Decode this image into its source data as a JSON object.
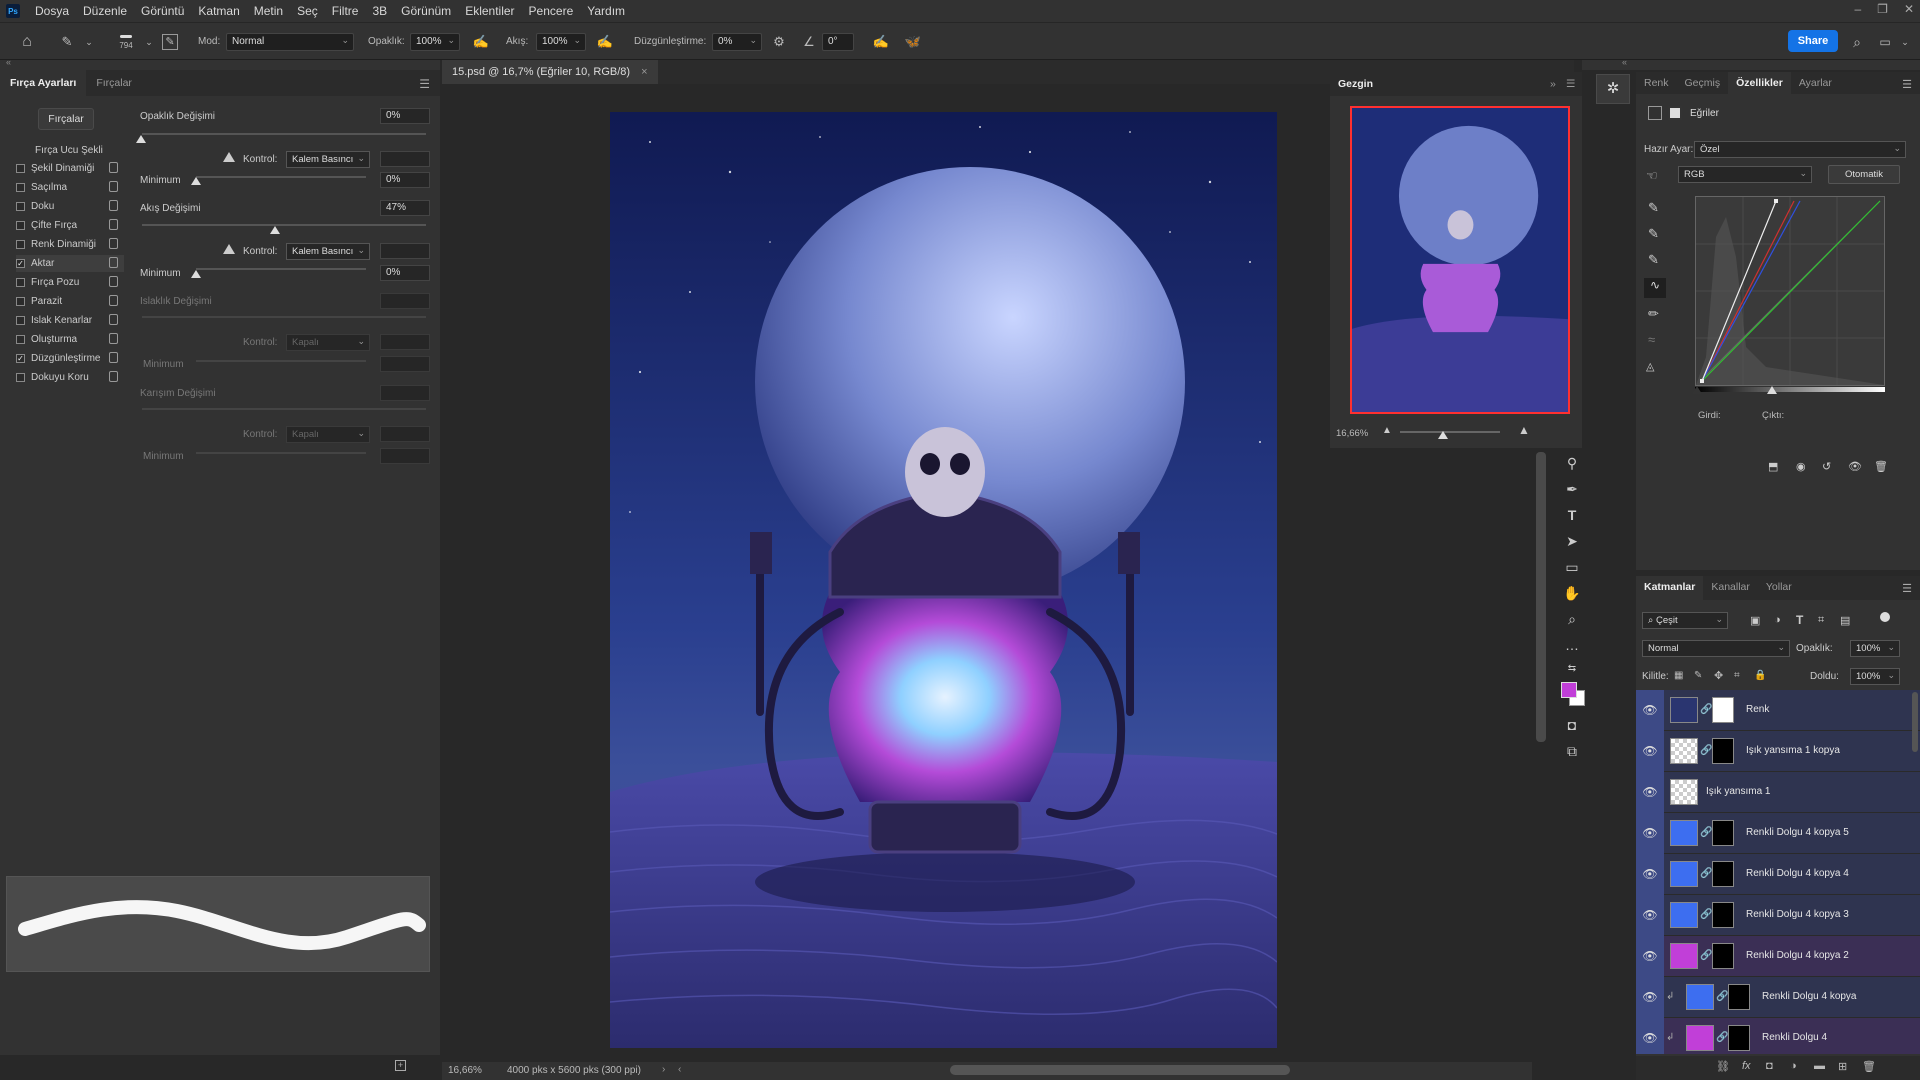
{
  "app": {
    "logo": "Ps"
  },
  "menu": [
    "Dosya",
    "Düzenle",
    "Görüntü",
    "Katman",
    "Metin",
    "Seç",
    "Filtre",
    "3B",
    "Görünüm",
    "Eklentiler",
    "Pencere",
    "Yardım"
  ],
  "options": {
    "brush_size": "794",
    "mode_label": "Mod:",
    "mode_value": "Normal",
    "opacity_label": "Opaklık:",
    "opacity_value": "100%",
    "flow_label": "Akış:",
    "flow_value": "100%",
    "smoothing_label": "Düzgünleştirme:",
    "smoothing_value": "0%",
    "angle_value": "0°",
    "share_label": "Share"
  },
  "brush_panel": {
    "tabs": [
      "Fırça Ayarları",
      "Fırçalar"
    ],
    "brushes_button": "Fırçalar",
    "tip_shape": "Fırça Ucu Şekli",
    "items": [
      {
        "label": "Şekil Dinamiği",
        "checked": false
      },
      {
        "label": "Saçılma",
        "checked": false
      },
      {
        "label": "Doku",
        "checked": false
      },
      {
        "label": "Çifte Fırça",
        "checked": false
      },
      {
        "label": "Renk Dinamiği",
        "checked": false
      },
      {
        "label": "Aktar",
        "checked": true
      },
      {
        "label": "Fırça Pozu",
        "checked": false
      },
      {
        "label": "Parazit",
        "checked": false
      },
      {
        "label": "Islak Kenarlar",
        "checked": false
      },
      {
        "label": "Oluşturma",
        "checked": false
      },
      {
        "label": "Düzgünleştirme",
        "checked": true
      },
      {
        "label": "Dokuyu Koru",
        "checked": false
      }
    ],
    "opacity_jitter": "Opaklık Değişimi",
    "opacity_jitter_value": "0%",
    "control": "Kontrol:",
    "pen_pressure": "Kalem Basıncı",
    "minimum": "Minimum",
    "min1_value": "0%",
    "flow_jitter": "Akış Değişimi",
    "flow_jitter_value": "47%",
    "min2_value": "0%",
    "wetness_jitter": "Islaklık Değişimi",
    "off": "Kapalı",
    "mix_jitter": "Karışım Değişimi"
  },
  "document": {
    "tab_title": "15.psd @ 16,7% (Eğriler 10, RGB/8)",
    "zoom": "16,66%",
    "info": "4000 pks x 5600 pks (300 ppi)"
  },
  "navigator": {
    "tab": "Gezgin",
    "zoom": "16,66%"
  },
  "properties": {
    "tabs": [
      "Renk",
      "Geçmiş",
      "Özellikler",
      "Ayarlar"
    ],
    "title": "Eğriler",
    "preset_label": "Hazır Ayar:",
    "preset_value": "Özel",
    "channel": "RGB",
    "auto_button": "Otomatik",
    "input_label": "Girdi:",
    "output_label": "Çıktı:"
  },
  "layers_panel": {
    "tabs": [
      "Katmanlar",
      "Kanallar",
      "Yollar"
    ],
    "filter": "Çeşit",
    "blend_mode": "Normal",
    "opacity_label": "Opaklık:",
    "opacity_value": "100%",
    "lock_label": "Kilitle:",
    "fill_label": "Doldu:",
    "fill_value": "100%",
    "layers": [
      {
        "name": "Renk",
        "color": "#2a3570",
        "mask": "#ffffff"
      },
      {
        "name": "Işık yansıma 1 kopya",
        "color": "checker",
        "mask": "#000000"
      },
      {
        "name": "Işık yansıma 1",
        "color": "checker",
        "mask": null
      },
      {
        "name": "Renkli Dolgu 4 kopya 5",
        "color": "#3d6ef0",
        "mask": "#000000"
      },
      {
        "name": "Renkli Dolgu 4 kopya 4",
        "color": "#3d6ef0",
        "mask": "#000000"
      },
      {
        "name": "Renkli Dolgu 4 kopya 3",
        "color": "#3d6ef0",
        "mask": "#000000"
      },
      {
        "name": "Renkli Dolgu 4 kopya 2",
        "color": "#c13fd8",
        "mask": "#000000"
      },
      {
        "name": "Renkli Dolgu 4 kopya",
        "color": "#3d6ef0",
        "mask": "#000000"
      },
      {
        "name": "Renkli Dolgu 4",
        "color": "#c13fd8",
        "mask": "#000000"
      }
    ]
  },
  "colors": {
    "accent": "#1473e6",
    "foreground": "#c13fd8",
    "background": "#ffffff"
  }
}
